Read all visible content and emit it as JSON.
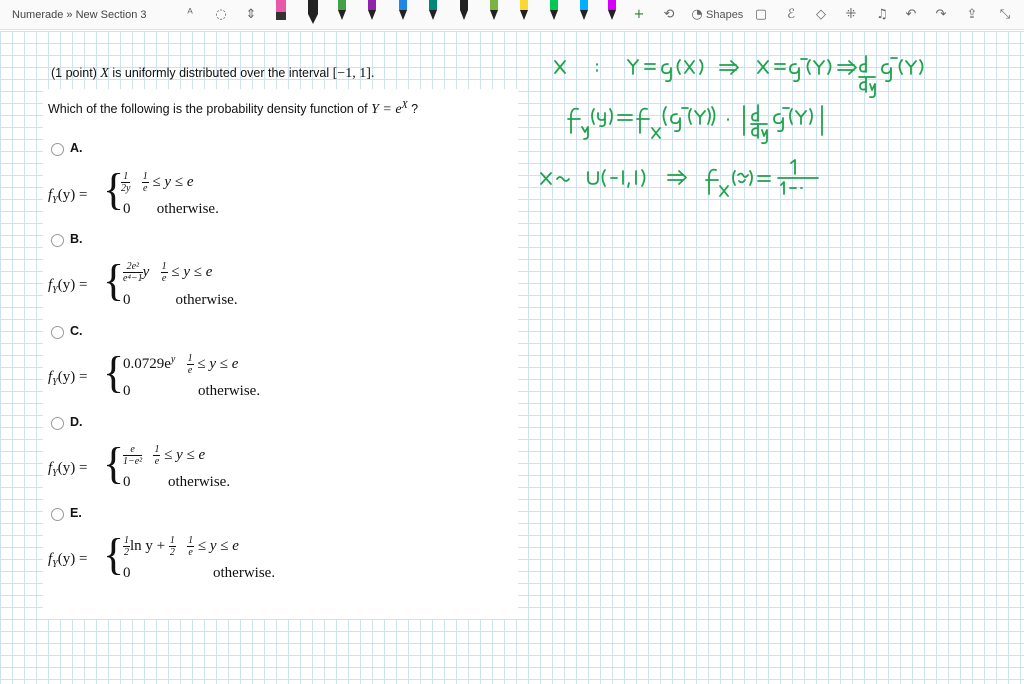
{
  "toolbar": {
    "title": "Numerade » New Section 3",
    "shapes_label": "Shapes",
    "icons": [
      "pointer-icon",
      "lasso-icon",
      "move-icon",
      "eraser-icon",
      "undo-icon",
      "redo-icon",
      "bell-icon",
      "ruler-icon",
      "share-icon",
      "collapse-icon"
    ],
    "pen_colors": [
      "#222222",
      "#e53935",
      "#1e88e5",
      "#8e24aa",
      "#3949ab",
      "#43a047",
      "#212121",
      "#ffeb3b",
      "#00c853",
      "#00b0ff",
      "#d500f9"
    ]
  },
  "question": {
    "intro_prefix": "(1 point)",
    "intro_var": "X",
    "intro_mid": "is uniformly distributed over the interval",
    "intro_interval": "[−1, 1].",
    "prompt_prefix": "Which of the following is the probability density function of",
    "prompt_expr": "Y = e",
    "prompt_sup": "X",
    "prompt_suffix": "?",
    "fy_label": "f",
    "fy_sub": "Y",
    "fy_arg": "(y) =",
    "range_lo_num": "1",
    "range_lo_den": "e",
    "range_tail": "≤ y ≤ e",
    "zero": "0",
    "otherwise": "otherwise.",
    "options": [
      {
        "label": "A.",
        "expr_num": "1",
        "expr_den": "2y",
        "expr_tail": ""
      },
      {
        "label": "B.",
        "expr_num": "2e²",
        "expr_den": "e⁴−1",
        "expr_tail": "y"
      },
      {
        "label": "C.",
        "expr_text": "0.0729e",
        "expr_sup": "y"
      },
      {
        "label": "D.",
        "expr_num": "e",
        "expr_den": "1−e²",
        "expr_tail": ""
      },
      {
        "label": "E.",
        "expr_num": "1",
        "expr_den": "2",
        "expr_tail": "ln y +",
        "expr_num2": "1",
        "expr_den2": "2"
      }
    ]
  },
  "ink_color": "#1fa34a"
}
